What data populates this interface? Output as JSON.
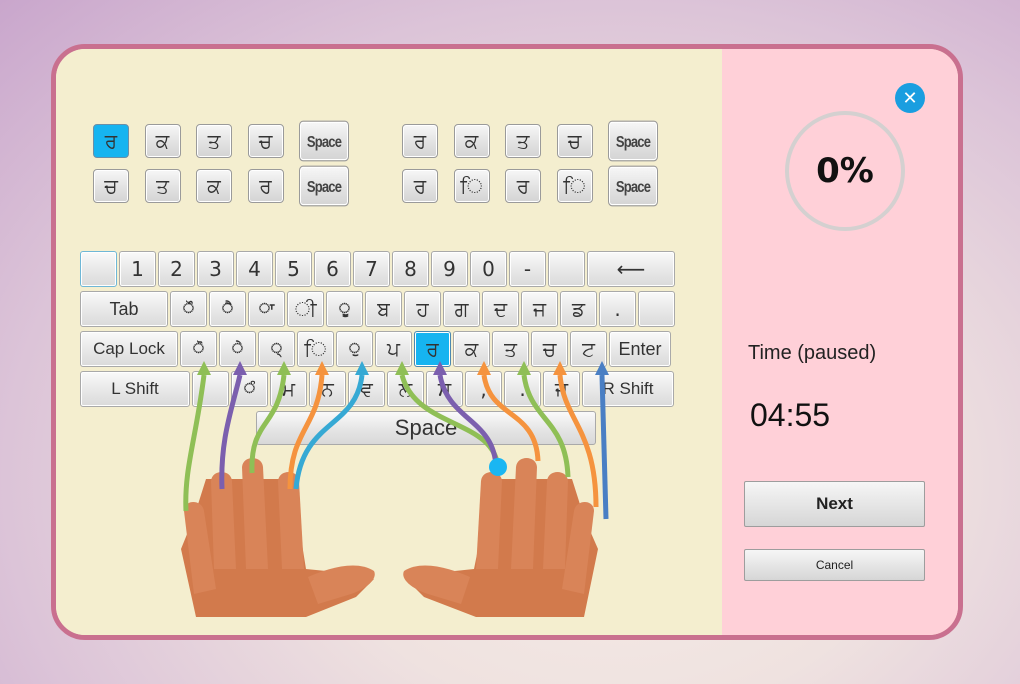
{
  "practice": {
    "rows": [
      [
        {
          "label": "ਰ",
          "active": true
        },
        {
          "label": "ਕ"
        },
        {
          "label": "ਤ"
        },
        {
          "label": "ਚ"
        },
        {
          "label": "Space",
          "space": true
        }
      ],
      [
        {
          "label": "ਚ"
        },
        {
          "label": "ਤ"
        },
        {
          "label": "ਕ"
        },
        {
          "label": "ਰ"
        },
        {
          "label": "Space",
          "space": true
        }
      ],
      [
        {
          "label": "ਰ"
        },
        {
          "label": "ਕ"
        },
        {
          "label": "ਤ"
        },
        {
          "label": "ਚ"
        },
        {
          "label": "Space",
          "space": true
        }
      ],
      [
        {
          "label": "ਰ"
        },
        {
          "label": "ਿ"
        },
        {
          "label": "ਰ"
        },
        {
          "label": "ਿ"
        },
        {
          "label": "Space",
          "space": true
        }
      ]
    ]
  },
  "keyboard": {
    "rows": [
      [
        {
          "label": "",
          "w": 37,
          "focus": true
        },
        {
          "label": "1"
        },
        {
          "label": "2"
        },
        {
          "label": "3"
        },
        {
          "label": "4"
        },
        {
          "label": "5"
        },
        {
          "label": "6"
        },
        {
          "label": "7"
        },
        {
          "label": "8"
        },
        {
          "label": "9"
        },
        {
          "label": "0"
        },
        {
          "label": "-"
        },
        {
          "label": ""
        },
        {
          "label": "⟵",
          "w": 88,
          "name": "backspace"
        }
      ],
      [
        {
          "label": "Tab",
          "w": 88,
          "lbl": true
        },
        {
          "label": "ੌ",
          "mark": true
        },
        {
          "label": "ੈ",
          "mark": true
        },
        {
          "label": "ਾ",
          "mark": true
        },
        {
          "label": "ੀ"
        },
        {
          "label": "ੂ",
          "mark": true
        },
        {
          "label": "ਬ"
        },
        {
          "label": "ਹ"
        },
        {
          "label": "ਗ"
        },
        {
          "label": "ਦ"
        },
        {
          "label": "ਜ"
        },
        {
          "label": "ਡ"
        },
        {
          "label": "."
        },
        {
          "label": "",
          "w": 36
        }
      ],
      [
        {
          "label": "Cap Lock",
          "w": 98,
          "lbl": true,
          "small": true
        },
        {
          "label": "ੋ",
          "mark": true
        },
        {
          "label": "ੇ",
          "mark": true
        },
        {
          "label": "੍",
          "mark": true
        },
        {
          "label": "ਿ"
        },
        {
          "label": "ੁ",
          "mark": true
        },
        {
          "label": "ਪ"
        },
        {
          "label": "ਰ",
          "active": true
        },
        {
          "label": "ਕ"
        },
        {
          "label": "ਤ"
        },
        {
          "label": "ਚ"
        },
        {
          "label": "ਟ"
        },
        {
          "label": "Enter",
          "w": 62,
          "lbl": true
        }
      ],
      [
        {
          "label": "L Shift",
          "w": 110,
          "lbl": true,
          "small": true
        },
        {
          "label": "",
          "w": 37
        },
        {
          "label": "ੰ",
          "mark": true
        },
        {
          "label": "ਮ"
        },
        {
          "label": "ਨ"
        },
        {
          "label": "ਵ"
        },
        {
          "label": "ਲ"
        },
        {
          "label": "ਸ"
        },
        {
          "label": ","
        },
        {
          "label": "."
        },
        {
          "label": "ਜ"
        },
        {
          "label": "R Shift",
          "w": 92,
          "lbl": true,
          "small": true
        }
      ]
    ],
    "space_label": "Space"
  },
  "finger_colors": {
    "pinky": "#8fbf56",
    "ring": "#7b5fae",
    "middle": "#8fbf56",
    "index_a": "#f5933e",
    "index_b": "#36a9d4",
    "right_pinky": "#4a7fc4",
    "highlight": "#1ab6f2"
  },
  "sidebar": {
    "close_icon": "close-icon",
    "progress_text": "0%",
    "progress_value": 0,
    "time_label": "Time (paused)",
    "time_value": "04:55",
    "next_label": "Next",
    "cancel_label": "Cancel"
  }
}
